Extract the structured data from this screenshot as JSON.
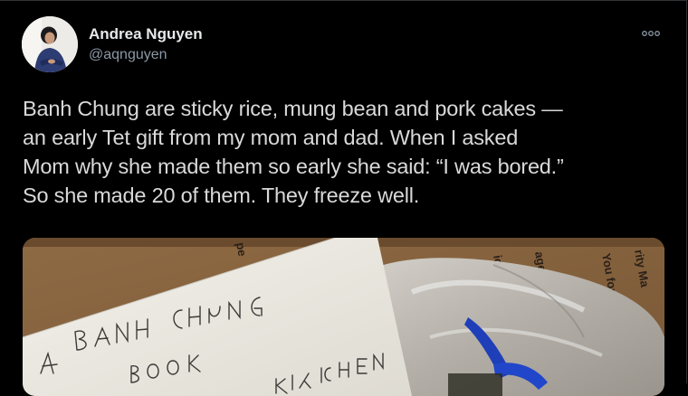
{
  "tweet": {
    "author_name": "Andrea Nguyen",
    "author_handle": "@aqnguyen",
    "lines": [
      "Banh Chung are sticky rice, mung bean and pork cakes —",
      "an early Tet gift from my mom and dad. When I asked",
      "Mom why she made them so early she said: “I was bored.”",
      "So she made 20 of them. They freeze well."
    ]
  },
  "icons": {
    "more": "more-options-icon"
  },
  "colors": {
    "background": "#000000",
    "text": "#d9d9d9",
    "handle": "#8b98a5",
    "border": "#2f3336"
  }
}
